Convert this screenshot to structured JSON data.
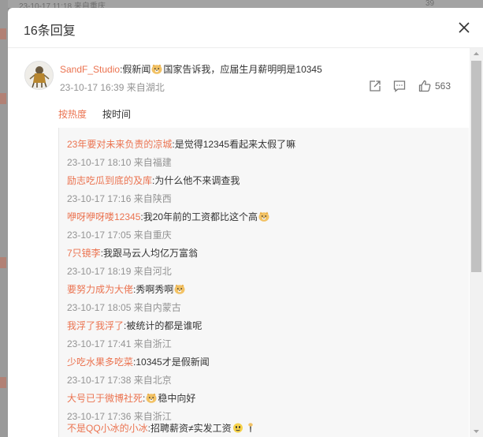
{
  "background": {
    "top_text": "23-10-17 11:18 来自重庆",
    "top_count": "39"
  },
  "dialog": {
    "title": "16条回复"
  },
  "comment": {
    "author": "SandF_Studio",
    "text_before": ":假新闻",
    "text_after": "国家告诉我，应届生月薪明明是10345",
    "time": "23-10-17 16:39",
    "location": "来自湖北",
    "like_count": "563"
  },
  "sort": {
    "hot": "按热度",
    "time": "按时间"
  },
  "replies": [
    {
      "author": "23年要对未来负责的凉城",
      "text": ":是觉得12345看起来太假了嘛",
      "emoji": "",
      "time": "23-10-17 18:10",
      "location": "来自福建"
    },
    {
      "author": "励志吃瓜到底的及库",
      "text": ":为什么他不来调查我",
      "emoji": "",
      "time": "23-10-17 17:16",
      "location": "来自陕西"
    },
    {
      "author": "咿呀咿呀喽12345",
      "text": ":我20年前的工资都比这个高",
      "emoji": "doge",
      "time": "23-10-17 17:05",
      "location": "来自重庆"
    },
    {
      "author": "7只镜李",
      "text": ":我跟马云人均亿万富翁",
      "emoji": "",
      "time": "23-10-17 18:19",
      "location": "来自河北"
    },
    {
      "author": "要努力成为大佬",
      "text": ":秀啊秀啊",
      "emoji": "doge",
      "time": "23-10-17 18:05",
      "location": "来自内蒙古"
    },
    {
      "author": "我浮了我浮了",
      "text": ":被统计的都是谁呢",
      "emoji": "",
      "time": "23-10-17 17:41",
      "location": "来自浙江"
    },
    {
      "author": "少吃水果多吃菜",
      "text": ":10345才是假新闻",
      "emoji": "",
      "time": "23-10-17 17:38",
      "location": "来自北京"
    },
    {
      "author": "大号已于微博社死",
      "text": "稳中向好",
      "emoji_before": "doge",
      "time": "23-10-17 17:36",
      "location": "来自浙江"
    },
    {
      "author": "不是QQ小冰的小冰",
      "text": ":招聘薪资≠实发工资",
      "emoji": "yellow-face",
      "time": "",
      "location": ""
    }
  ],
  "colors": {
    "accent": "#eb7350",
    "meta": "#939393",
    "text": "#333333",
    "reply_bg": "#f7f7f7"
  },
  "icons": {
    "close": "close-icon",
    "share": "share-icon",
    "comment": "comment-icon",
    "like": "thumbs-up-icon"
  }
}
